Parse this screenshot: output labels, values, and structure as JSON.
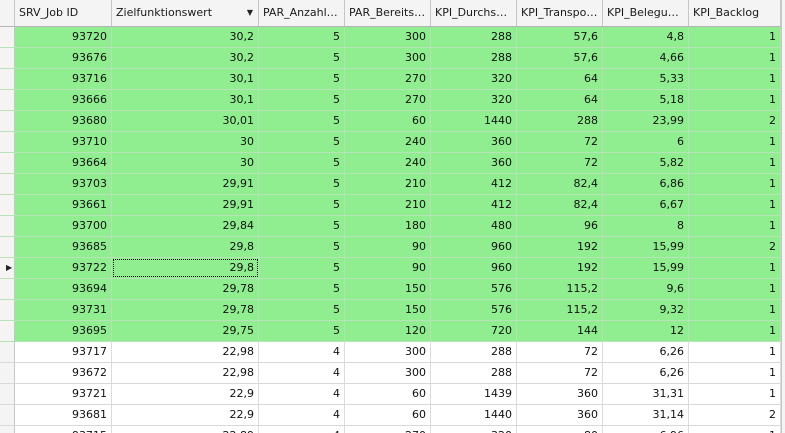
{
  "columns": [
    {
      "label": "SRV_Job ID"
    },
    {
      "label": "Zielfunktionswert",
      "sorted": "descending"
    },
    {
      "label": "PAR_Anzahl F..."
    },
    {
      "label": "PAR_Bereitst..."
    },
    {
      "label": "KPI_Durchsatz"
    },
    {
      "label": "KPI_Transport..."
    },
    {
      "label": "KPI_Belegung ..."
    },
    {
      "label": "KPI_Backlog"
    }
  ],
  "highlight_color": "#90ee90",
  "current_row_index": 11,
  "rows": [
    {
      "highlight": true,
      "cells": [
        "93720",
        "30,2",
        "5",
        "300",
        "288",
        "57,6",
        "4,8",
        "1"
      ]
    },
    {
      "highlight": true,
      "cells": [
        "93676",
        "30,2",
        "5",
        "300",
        "288",
        "57,6",
        "4,66",
        "1"
      ]
    },
    {
      "highlight": true,
      "cells": [
        "93716",
        "30,1",
        "5",
        "270",
        "320",
        "64",
        "5,33",
        "1"
      ]
    },
    {
      "highlight": true,
      "cells": [
        "93666",
        "30,1",
        "5",
        "270",
        "320",
        "64",
        "5,18",
        "1"
      ]
    },
    {
      "highlight": true,
      "cells": [
        "93680",
        "30,01",
        "5",
        "60",
        "1440",
        "288",
        "23,99",
        "2"
      ]
    },
    {
      "highlight": true,
      "cells": [
        "93710",
        "30",
        "5",
        "240",
        "360",
        "72",
        "6",
        "1"
      ]
    },
    {
      "highlight": true,
      "cells": [
        "93664",
        "30",
        "5",
        "240",
        "360",
        "72",
        "5,82",
        "1"
      ]
    },
    {
      "highlight": true,
      "cells": [
        "93703",
        "29,91",
        "5",
        "210",
        "412",
        "82,4",
        "6,86",
        "1"
      ]
    },
    {
      "highlight": true,
      "cells": [
        "93661",
        "29,91",
        "5",
        "210",
        "412",
        "82,4",
        "6,67",
        "1"
      ]
    },
    {
      "highlight": true,
      "cells": [
        "93700",
        "29,84",
        "5",
        "180",
        "480",
        "96",
        "8",
        "1"
      ]
    },
    {
      "highlight": true,
      "cells": [
        "93685",
        "29,8",
        "5",
        "90",
        "960",
        "192",
        "15,99",
        "2"
      ]
    },
    {
      "highlight": true,
      "cells": [
        "93722",
        "29,8",
        "5",
        "90",
        "960",
        "192",
        "15,99",
        "1"
      ],
      "current": true
    },
    {
      "highlight": true,
      "cells": [
        "93694",
        "29,78",
        "5",
        "150",
        "576",
        "115,2",
        "9,6",
        "1"
      ]
    },
    {
      "highlight": true,
      "cells": [
        "93731",
        "29,78",
        "5",
        "150",
        "576",
        "115,2",
        "9,32",
        "1"
      ]
    },
    {
      "highlight": true,
      "cells": [
        "93695",
        "29,75",
        "5",
        "120",
        "720",
        "144",
        "12",
        "1"
      ]
    },
    {
      "highlight": false,
      "cells": [
        "93717",
        "22,98",
        "4",
        "300",
        "288",
        "72",
        "6,26",
        "1"
      ]
    },
    {
      "highlight": false,
      "cells": [
        "93672",
        "22,98",
        "4",
        "300",
        "288",
        "72",
        "6,26",
        "1"
      ]
    },
    {
      "highlight": false,
      "cells": [
        "93721",
        "22,9",
        "4",
        "60",
        "1439",
        "360",
        "31,31",
        "1"
      ]
    },
    {
      "highlight": false,
      "cells": [
        "93681",
        "22,9",
        "4",
        "60",
        "1440",
        "360",
        "31,14",
        "2"
      ]
    },
    {
      "highlight": false,
      "cells": [
        "93715",
        "22,89",
        "4",
        "270",
        "320",
        "80",
        "6,96",
        "1"
      ]
    }
  ]
}
